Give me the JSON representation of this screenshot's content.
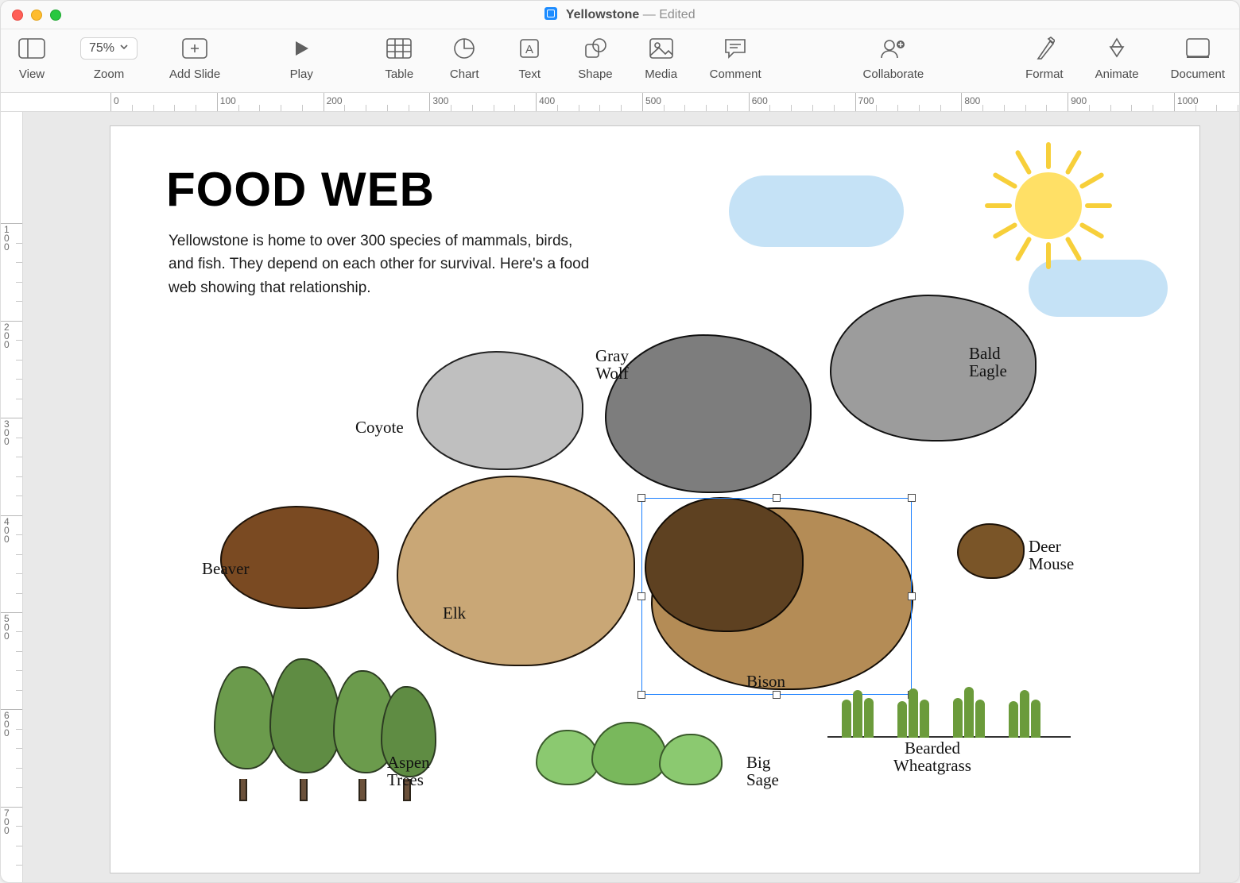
{
  "window": {
    "doc_title": "Yellowstone",
    "edited_suffix": " — Edited"
  },
  "toolbar": {
    "view": "View",
    "zoom": "Zoom",
    "zoom_value": "75%",
    "add_slide": "Add Slide",
    "play": "Play",
    "table": "Table",
    "chart": "Chart",
    "text": "Text",
    "shape": "Shape",
    "media": "Media",
    "comment": "Comment",
    "collaborate": "Collaborate",
    "format": "Format",
    "animate": "Animate",
    "document": "Document"
  },
  "ruler_h_labels": [
    "0",
    "100",
    "200",
    "300",
    "400",
    "500",
    "600",
    "700",
    "800",
    "900",
    "1000"
  ],
  "ruler_v_labels": [
    "100",
    "200",
    "300",
    "400",
    "500",
    "600",
    "700"
  ],
  "slide": {
    "title": "FOOD WEB",
    "body": "Yellowstone is home to over 300 species of mammals, birds, and fish. They depend on each other for survival. Here's a food web showing that relationship.",
    "labels": {
      "coyote": "Coyote",
      "gray_wolf": "Gray\nWolf",
      "bald_eagle": "Bald\nEagle",
      "beaver": "Beaver",
      "elk": "Elk",
      "bison": "Bison",
      "deer_mouse": "Deer\nMouse",
      "aspen_trees": "Aspen\nTrees",
      "big_sage": "Big\nSage",
      "bearded_wheatgrass": "Bearded\nWheatgrass"
    },
    "selected_object": "bison"
  }
}
